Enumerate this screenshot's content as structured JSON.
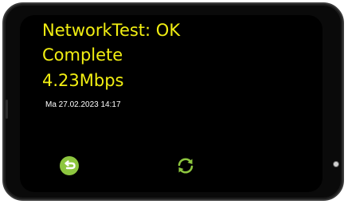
{
  "screen": {
    "status_line": "NetworkTest: OK",
    "result_line": "Complete",
    "speed_line": "4.23Mbps",
    "timestamp": "Ma 27.02.2023 14:17"
  },
  "controls": {
    "back_icon": "back-arrow-icon",
    "refresh_icon": "refresh-icon"
  },
  "colors": {
    "text_primary": "#f2ef12",
    "icon_green": "#8dc63f",
    "screen_bg": "#000000",
    "timestamp_text": "#ffffff"
  }
}
